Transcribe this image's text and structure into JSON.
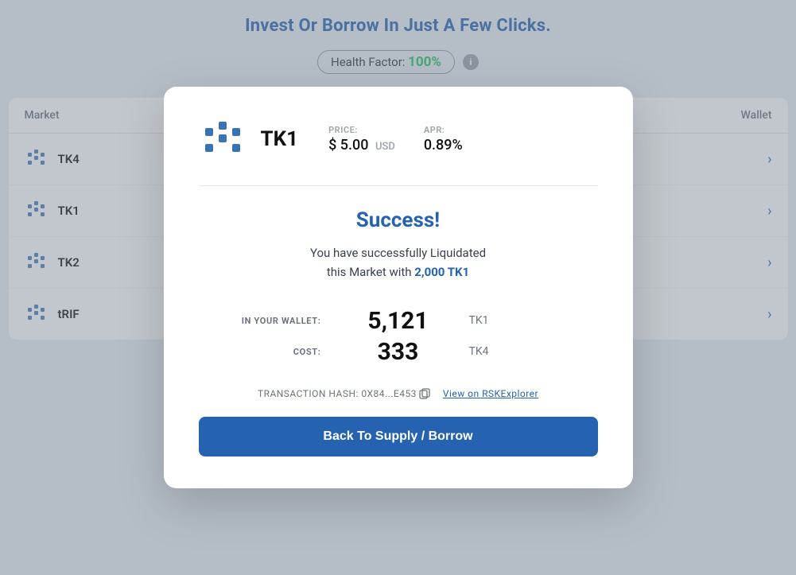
{
  "page": {
    "title": "Invest Or Borrow In Just A Few Clicks.",
    "health_factor_label": "Health Factor:",
    "health_factor_value": "100%",
    "info_tooltip": "i"
  },
  "table": {
    "headers": [
      "Market",
      "",
      "",
      "",
      "Wallet"
    ],
    "rows": [
      {
        "token": "TK4",
        "chevron": "›"
      },
      {
        "token": "TK1",
        "chevron": "›"
      },
      {
        "token": "TK2",
        "chevron": "›"
      },
      {
        "token": "tRIF",
        "chevron": "›"
      }
    ]
  },
  "modal": {
    "token_name": "TK1",
    "price_label": "PRICE:",
    "price_value": "$ 5.00",
    "price_currency": "USD",
    "apr_label": "APR:",
    "apr_value": "0.89%",
    "success_title": "Success!",
    "success_message_1": "You have successfully Liquidated",
    "success_message_2": "this Market with",
    "success_amount": "2,000 TK1",
    "wallet_label": "IN YOUR WALLET:",
    "wallet_value": "5,121",
    "wallet_token": "TK1",
    "cost_label": "COST:",
    "cost_value": "333",
    "cost_token": "TK4",
    "tx_hash_label": "TRANSACTION HASH: 0X84...E453",
    "tx_link_label": "View on RSKExplorer",
    "back_button": "Back To Supply / Borrow"
  }
}
